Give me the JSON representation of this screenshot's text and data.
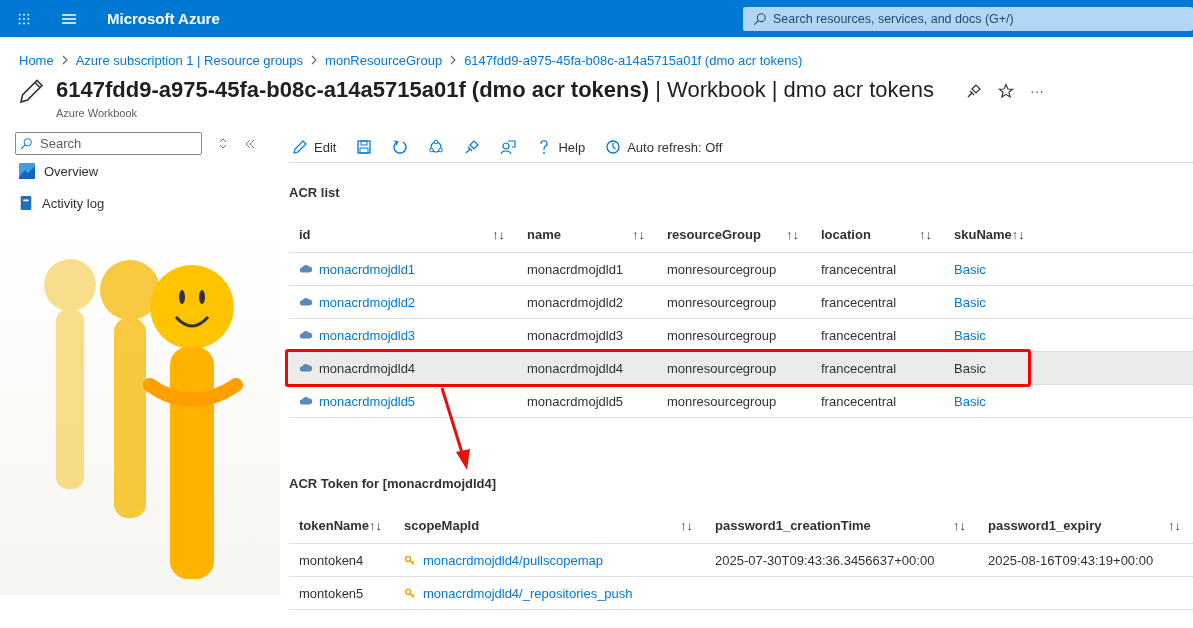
{
  "topbar": {
    "title": "Microsoft Azure",
    "search": {
      "placeholder": "Search resources, services, and docs (G+/)"
    }
  },
  "breadcrumb": [
    "Home",
    "Azure subscription 1 | Resource groups",
    "monResourceGroup",
    "6147fdd9-a975-45fa-b08c-a14a5715a01f (dmo acr tokens)"
  ],
  "page": {
    "title": "**6147fdd9-a975-45fa-b08c-a14a5715a01f (dmo acr tokens)** | Workbook | dmo acr tokens",
    "subtitle": "Azure Workbook",
    "more": "···"
  },
  "sidebar": {
    "search": {
      "placeholder": "Search"
    },
    "items": [
      {
        "kind": "overview",
        "label": "Overview"
      },
      {
        "kind": "activity",
        "label": "Activity log"
      }
    ]
  },
  "toolbar": [
    {
      "kind": "edit",
      "label": "Edit"
    },
    {
      "kind": "save"
    },
    {
      "kind": "refresh"
    },
    {
      "kind": "share"
    },
    {
      "kind": "pin"
    },
    {
      "kind": "feedback"
    },
    {
      "kind": "help",
      "label": "Help"
    },
    {
      "kind": "autorefresh",
      "label": "Auto refresh: Off"
    }
  ],
  "acr_list": {
    "title": "ACR list",
    "columns": [
      {
        "label": "id",
        "sort": "↑↓",
        "kind": "resource"
      },
      {
        "label": "name",
        "sort": "↑↓",
        "kind": "text"
      },
      {
        "label": "resourceGroup",
        "sort": "↑↓",
        "kind": "text"
      },
      {
        "label": "location",
        "sort": "↑↓",
        "kind": "text"
      },
      {
        "label": "skuName",
        "sort": "↑↓",
        "kind": "link"
      }
    ],
    "rows": [
      {
        "selected": false,
        "cells": [
          "monacrdmojdld1",
          "monacrdmojdld1",
          "monresourcegroup",
          "francecentral",
          "Basic"
        ]
      },
      {
        "selected": false,
        "cells": [
          "monacrdmojdld2",
          "monacrdmojdld2",
          "monresourcegroup",
          "francecentral",
          "Basic"
        ]
      },
      {
        "selected": false,
        "cells": [
          "monacrdmojdld3",
          "monacrdmojdld3",
          "monresourcegroup",
          "francecentral",
          "Basic"
        ]
      },
      {
        "selected": true,
        "cells": [
          "monacrdmojdld4",
          "monacrdmojdld4",
          "monresourcegroup",
          "francecentral",
          "Basic"
        ]
      },
      {
        "selected": false,
        "cells": [
          "monacrdmojdld5",
          "monacrdmojdld5",
          "monresourcegroup",
          "francecentral",
          "Basic"
        ]
      }
    ]
  },
  "token_table": {
    "title": "ACR Token for [monacrdmojdld4]",
    "columns": [
      {
        "label": "tokenName",
        "sort": "↑↓",
        "kind": "text"
      },
      {
        "label": "scopeMapId",
        "sort": "↑↓",
        "kind": "scope"
      },
      {
        "label": "password1_creationTime",
        "sort": "↑↓",
        "kind": "text"
      },
      {
        "label": "password1_expiry",
        "sort": "↑↓",
        "kind": "text"
      }
    ],
    "rows": [
      {
        "cells": [
          "montoken4",
          "monacrdmojdld4/pullscopemap",
          "2025-07-30T09:43:36.3456637+00:00",
          "2025-08-16T09:43:19+00:00"
        ]
      },
      {
        "cells": [
          "montoken5",
          "monacrdmojdld4/_repositories_push"
        ]
      }
    ]
  }
}
